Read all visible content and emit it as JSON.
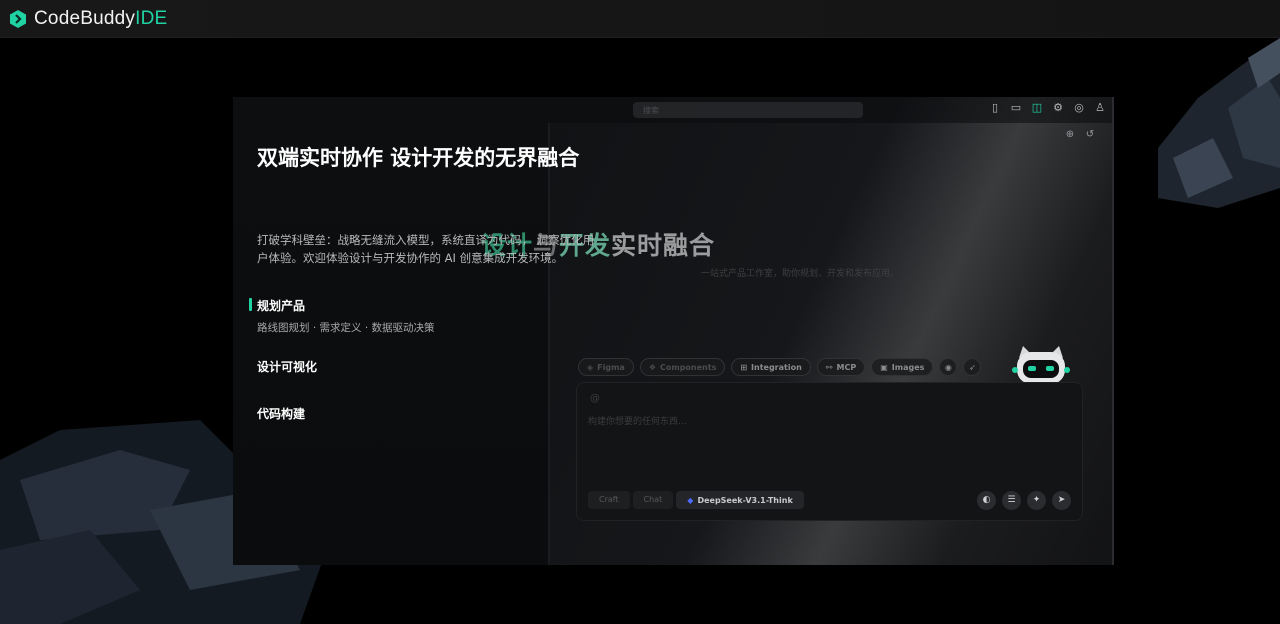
{
  "brand": {
    "name": "CodeBuddy",
    "suffix": "IDE",
    "accent": "#1fd3a3",
    "logo_icon": "codebuddy-logo-icon"
  },
  "left": {
    "title": "双端实时协作 设计开发的无界融合",
    "description": "打破学科壁垒：战略无缝流入模型，系统直译为代码， 洞察优化用户体验。欢迎体验设计与开发协作的 AI 创意集成开发环境。",
    "features": [
      {
        "label": "规划产品",
        "sub": "路线图规划 · 需求定义 · 数据驱动决策",
        "active": true
      },
      {
        "label": "设计可视化"
      },
      {
        "label": "代码构建"
      }
    ]
  },
  "preview": {
    "search_placeholder": "搜索",
    "toolbar_icons": [
      "sidebar-left-icon",
      "panel-bottom-icon",
      "sidebar-right-icon",
      "gear-icon",
      "browser-icon",
      "user-icon"
    ],
    "chat_icons": [
      "new-chat-icon",
      "history-icon"
    ],
    "hero": {
      "t1": "设计",
      "t2": "与",
      "t3": "开发",
      "t4": "实时融合",
      "subtitle": "一站式产品工作室，助你规划、开发和发布应用。"
    },
    "chips": [
      "Figma",
      "Components",
      "Integration",
      "MCP",
      "Images"
    ],
    "chat_at": "@",
    "chat_placeholder": "构建你想要的任何东西...",
    "modes": [
      "Craft",
      "Chat"
    ],
    "model": "DeepSeek-V3.1-Think",
    "actions": [
      "palette-icon",
      "list-icon",
      "sparkle-icon",
      "send-icon"
    ]
  }
}
